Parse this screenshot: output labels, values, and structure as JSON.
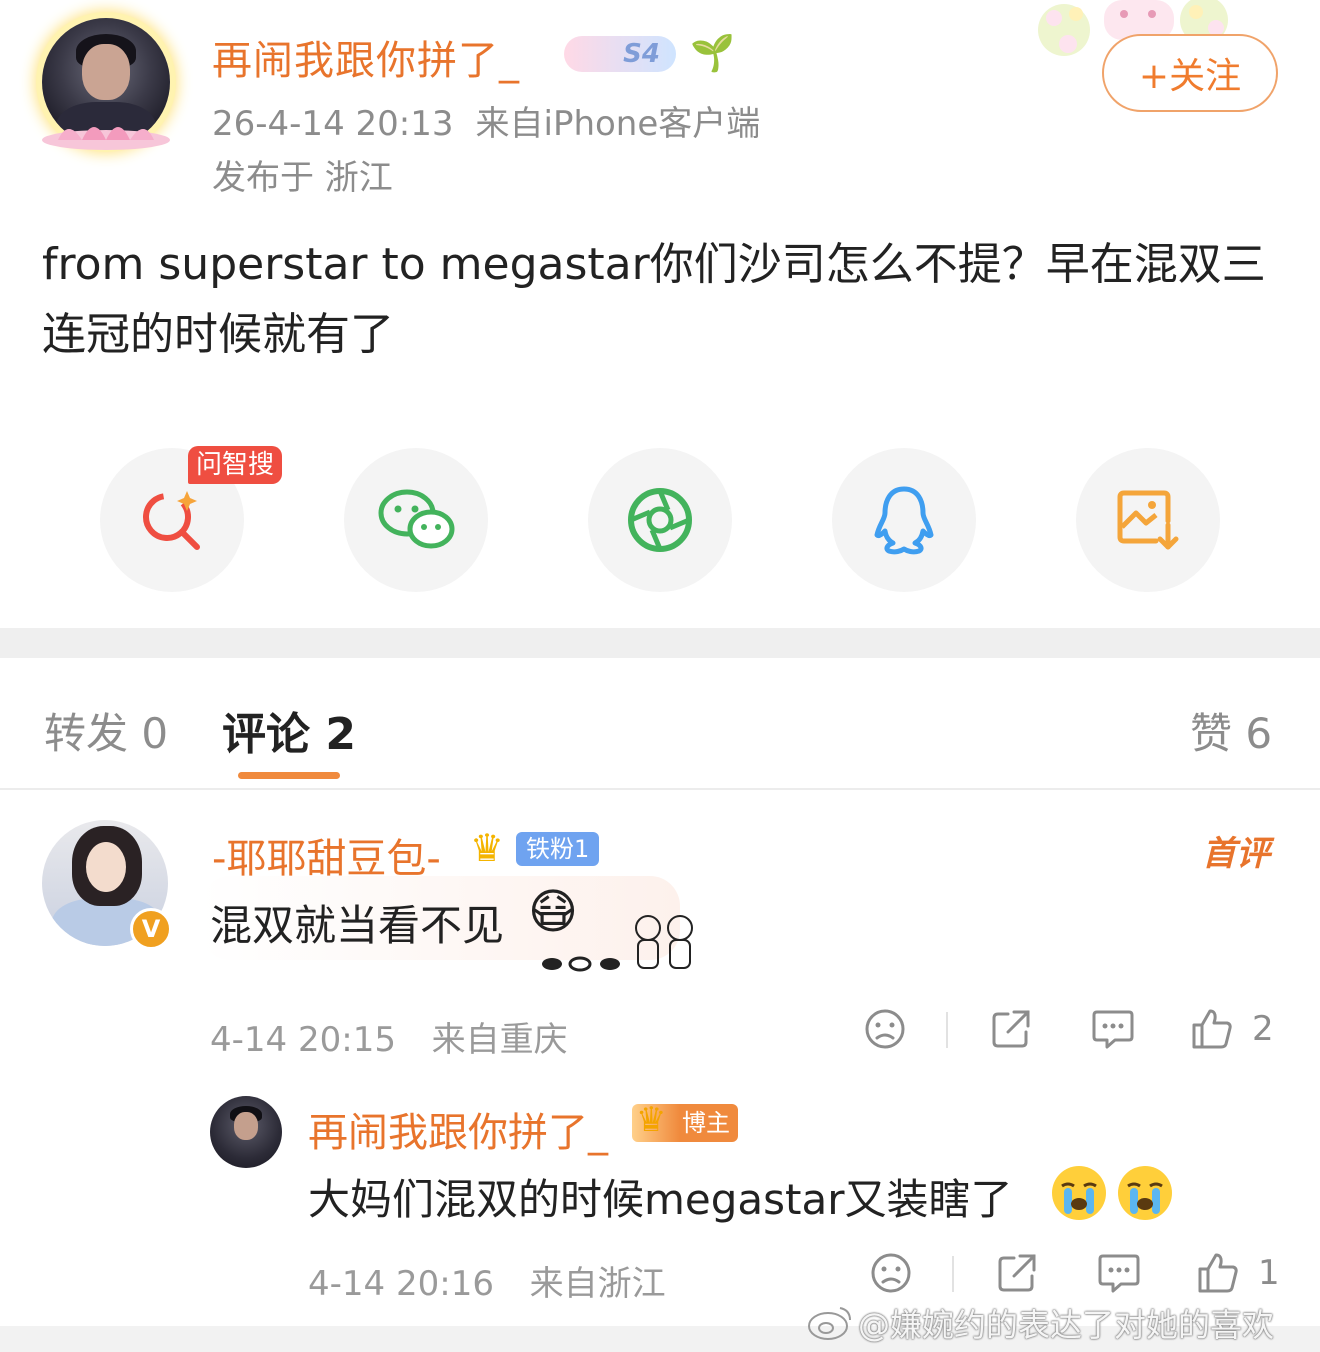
{
  "post": {
    "author": "再闹我跟你拼了_",
    "badge": "S4",
    "time": "26-4-14 20:13",
    "source": "来自iPhone客户端",
    "location": "发布于 浙江",
    "follow_label": "+关注",
    "text": "from superstar to megastar你们沙司怎么不提？早在混双三连冠的时候就有了"
  },
  "share": {
    "tag": "问智搜",
    "items": [
      "smart-search-icon",
      "wechat-icon",
      "moments-icon",
      "qq-icon",
      "save-image-icon"
    ]
  },
  "tabs": {
    "repost": "转发 0",
    "comment": "评论 2",
    "like": "赞 6"
  },
  "comments": [
    {
      "name": "-耶耶甜豆包-",
      "fan_badge": "铁粉1",
      "first_tag": "首评",
      "text": "混双就当看不见",
      "time": "4-14 20:15",
      "location": "来自重庆",
      "likes": "2"
    }
  ],
  "reply": {
    "name": "再闹我跟你拼了_",
    "badge": "博主",
    "text": "大妈们混双的时候megastar又装瞎了",
    "time": "4-14 20:16",
    "location": "来自浙江",
    "likes": "1"
  },
  "watermark": "@嫌婉约的表达了对她的喜欢",
  "colors": {
    "accent": "#e8742c",
    "follow_border": "#f0a36a",
    "tab_underline": "#f08a3d",
    "search_red": "#ef4e41",
    "wechat_green": "#43b35c",
    "qq_blue": "#3f9ef0",
    "save_orange": "#f4a53a"
  }
}
